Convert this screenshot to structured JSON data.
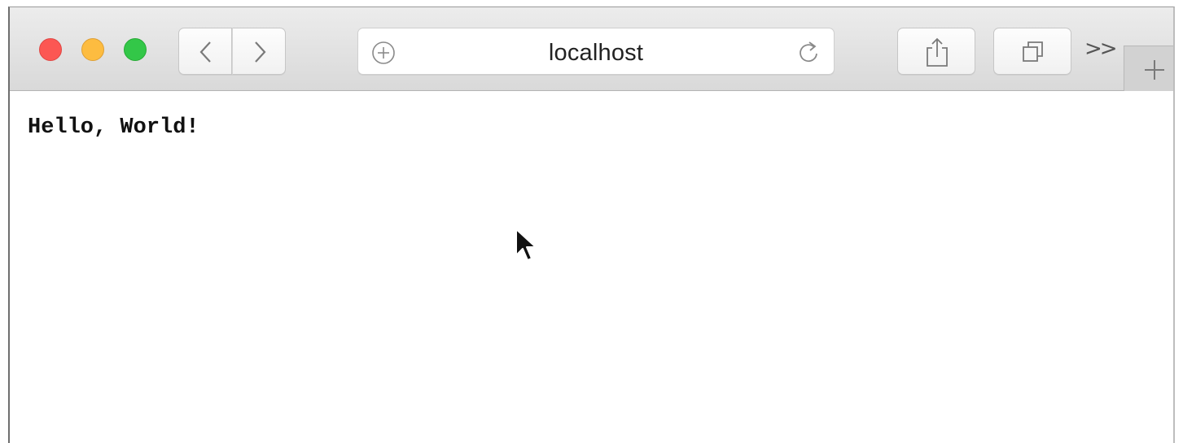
{
  "browser": {
    "url": "localhost",
    "new_tab_symbol": "+",
    "overflow_symbol": ">>"
  },
  "page": {
    "body_text": "Hello, World!"
  },
  "icons": {
    "back": "chevron-left-icon",
    "forward": "chevron-right-icon",
    "add_page": "plus-circle-icon",
    "reload": "reload-icon",
    "share": "share-icon",
    "tabs": "tabs-overview-icon",
    "cursor": "mouse-cursor-icon"
  },
  "colors": {
    "close": "#fc5753",
    "minimize": "#fdbc40",
    "maximize": "#33c748",
    "toolbar": "#e3e3e3"
  }
}
